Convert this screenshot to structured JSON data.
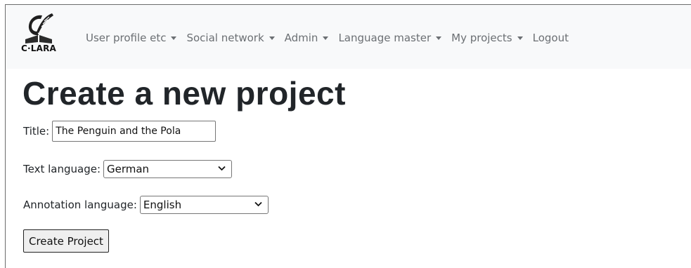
{
  "logo": {
    "text": "C·LARA"
  },
  "nav": {
    "items": [
      {
        "label": "User profile etc",
        "dropdown": true
      },
      {
        "label": "Social network",
        "dropdown": true
      },
      {
        "label": "Admin",
        "dropdown": true
      },
      {
        "label": "Language master",
        "dropdown": true
      },
      {
        "label": "My projects",
        "dropdown": true
      },
      {
        "label": "Logout",
        "dropdown": false
      }
    ]
  },
  "page": {
    "title": "Create a new project"
  },
  "form": {
    "title_label": "Title:",
    "title_value": "The Penguin and the Pola",
    "text_language_label": "Text language:",
    "text_language_value": "German",
    "annotation_language_label": "Annotation language:",
    "annotation_language_value": "English",
    "submit_label": "Create Project"
  },
  "colors": {
    "navbar_bg": "#f8f9fa",
    "nav_text": "#6b6f73",
    "heading": "#212529"
  }
}
